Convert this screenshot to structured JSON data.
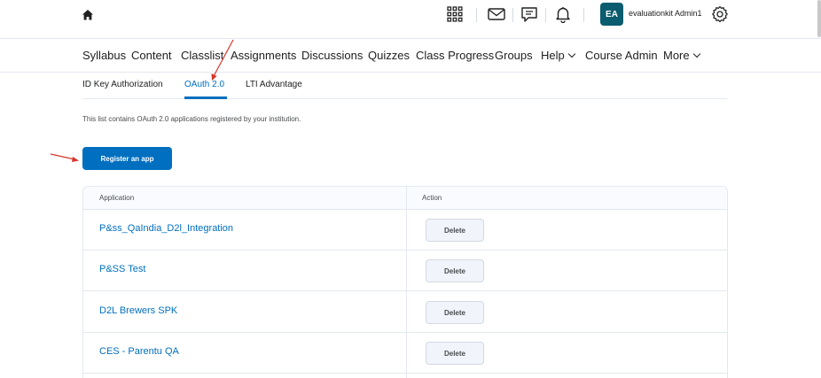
{
  "topbar": {
    "icons": [
      "home-icon",
      "apps-grid-icon",
      "mail-icon",
      "chat-icon",
      "bell-icon",
      "gear-icon"
    ],
    "avatar_initials": "EA",
    "avatar_color": "#0b5c6e",
    "username": "evaluationkit Admin1"
  },
  "nav": {
    "items": [
      "Syllabus",
      "Content",
      "Classlist",
      "Assignments",
      "Discussions",
      "Quizzes",
      "Class Progress",
      "Groups",
      "Help",
      "Course Admin",
      "More"
    ]
  },
  "subtabs": {
    "items": [
      "ID Key Authorization",
      "OAuth 2.0",
      "LTI Advantage"
    ],
    "active": "OAuth 2.0"
  },
  "description": "This list contains OAuth 2.0 applications registered by your institution.",
  "register_button": "Register an app",
  "table": {
    "headers": [
      "Application",
      "Action"
    ],
    "rows": [
      {
        "app": "P&ss_QaIndia_D2l_Integration",
        "action": "Delete"
      },
      {
        "app": "P&SS Test",
        "action": "Delete"
      },
      {
        "app": "D2L Brewers SPK",
        "action": "Delete"
      },
      {
        "app": "CES - Parentu QA",
        "action": "Delete"
      }
    ]
  },
  "colors": {
    "primary": "#006fbf",
    "annotation_arrow": "#d9352b"
  }
}
